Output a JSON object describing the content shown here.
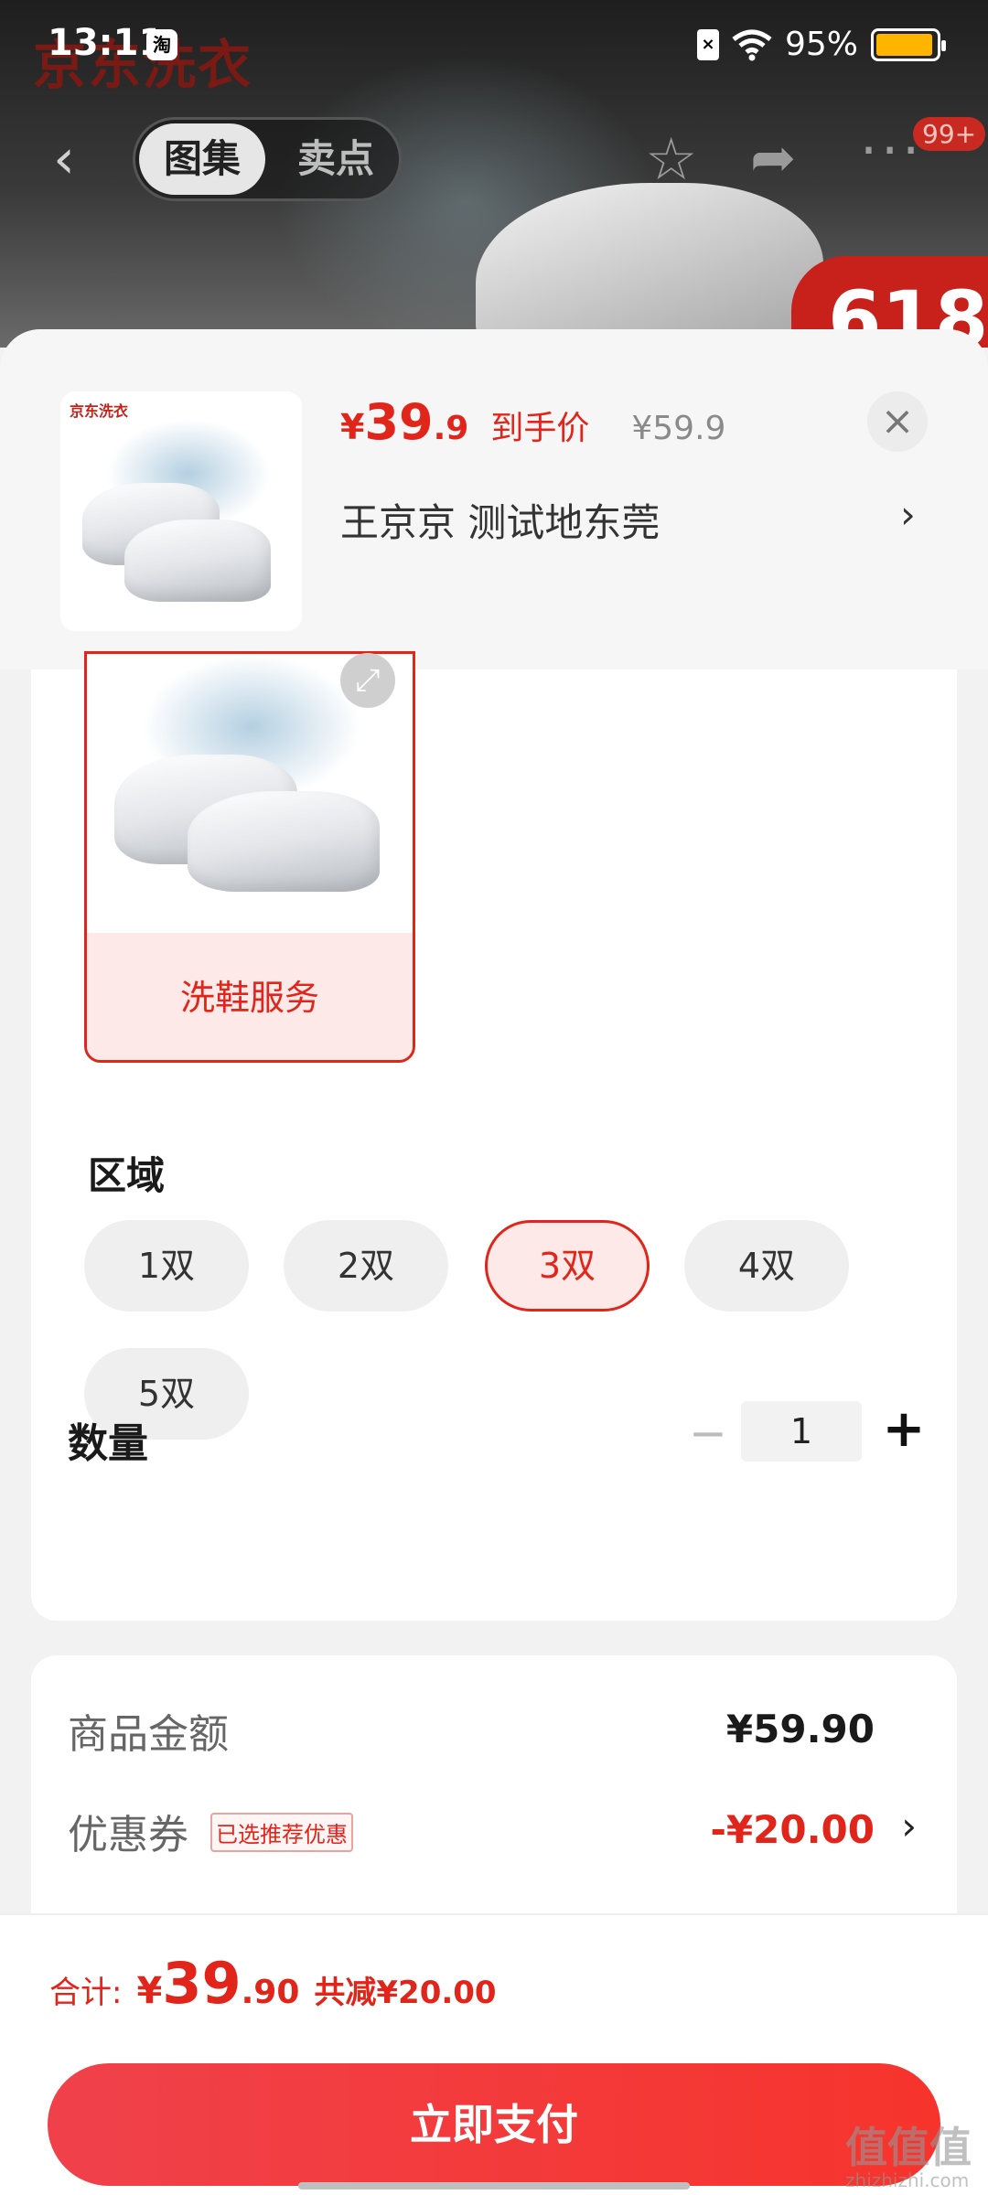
{
  "status_bar": {
    "time": "13:11",
    "app_icon": "淘",
    "battery": "95%",
    "battery_level": 0.95,
    "sim_icon": "sim-off-icon",
    "wifi_icon": "wifi-icon"
  },
  "background": {
    "brand": "京东洗衣",
    "promo": "618"
  },
  "nav": {
    "tabs": [
      "图集",
      "卖点"
    ],
    "badge": "99+",
    "back_icon": "back-icon",
    "star_icon": "star-icon",
    "share_icon": "share-icon",
    "more_icon": "more-icon"
  },
  "product": {
    "thumb_brand": "京东洗衣",
    "price_currency": "¥",
    "price_int": "39",
    "price_dec": ".9",
    "price_tag": "到手价",
    "original_price": "¥59.9",
    "address": "王京京  测试地东莞",
    "chevron": "›",
    "close": "×"
  },
  "service": {
    "label": "洗鞋服务",
    "expand_icon": "expand-icon"
  },
  "region": {
    "title": "区域",
    "options": [
      "1双",
      "2双",
      "3双",
      "4双",
      "5双"
    ],
    "selected": "3双"
  },
  "quantity": {
    "label": "数量",
    "minus": "−",
    "value": "1",
    "plus": "+"
  },
  "summary": {
    "amount_label": "商品金额",
    "amount_value": "¥59.90",
    "coupon_label": "优惠券",
    "coupon_badge": "已选推荐优惠",
    "coupon_value": "-¥20.00",
    "chevron": "›"
  },
  "footer": {
    "total_label": "合计:",
    "total_currency": "¥",
    "total_int": "39",
    "total_dec": ".90",
    "total_saved": "共减¥20.00",
    "pay_button": "立即支付"
  },
  "watermark": {
    "text": "值值值",
    "sub": "zhizhizhi.com"
  },
  "colors": {
    "accent": "#e1251b",
    "chip_bg": "#efefef",
    "selected_bg": "#fde9e8",
    "battery": "#ffb400"
  }
}
